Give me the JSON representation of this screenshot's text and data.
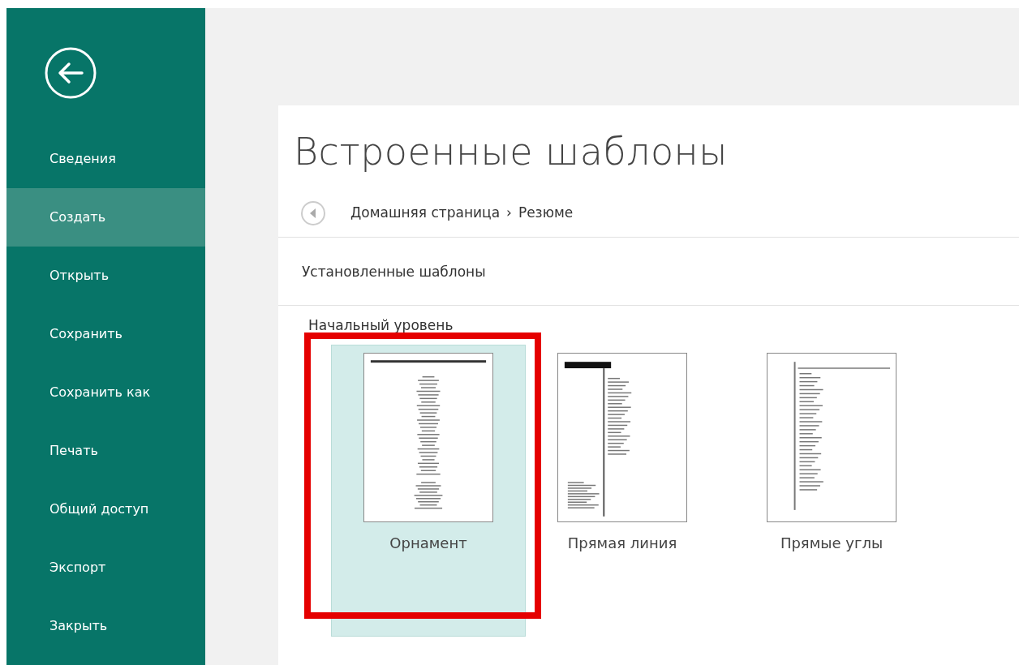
{
  "sidebar": {
    "items": [
      {
        "label": "Сведения",
        "selected": false
      },
      {
        "label": "Создать",
        "selected": true
      },
      {
        "label": "Открыть",
        "selected": false
      },
      {
        "label": "Сохранить",
        "selected": false
      },
      {
        "label": "Сохранить как",
        "selected": false
      },
      {
        "label": "Печать",
        "selected": false
      },
      {
        "label": "Общий доступ",
        "selected": false
      },
      {
        "label": "Экспорт",
        "selected": false
      },
      {
        "label": "Закрыть",
        "selected": false
      }
    ]
  },
  "title": "Встроенные шаблоны",
  "breadcrumb": {
    "items": [
      "Домашняя страница",
      "Резюме"
    ],
    "separator": "›"
  },
  "section": "Установленные шаблоны",
  "group": "Начальный уровень",
  "templates": [
    {
      "label": "Орнамент",
      "kind": "centered",
      "selected": true,
      "highlighted": true
    },
    {
      "label": "Прямая линия",
      "kind": "sidebar",
      "selected": false,
      "highlighted": false
    },
    {
      "label": "Прямые углы",
      "kind": "rule",
      "selected": false,
      "highlighted": false
    }
  ]
}
